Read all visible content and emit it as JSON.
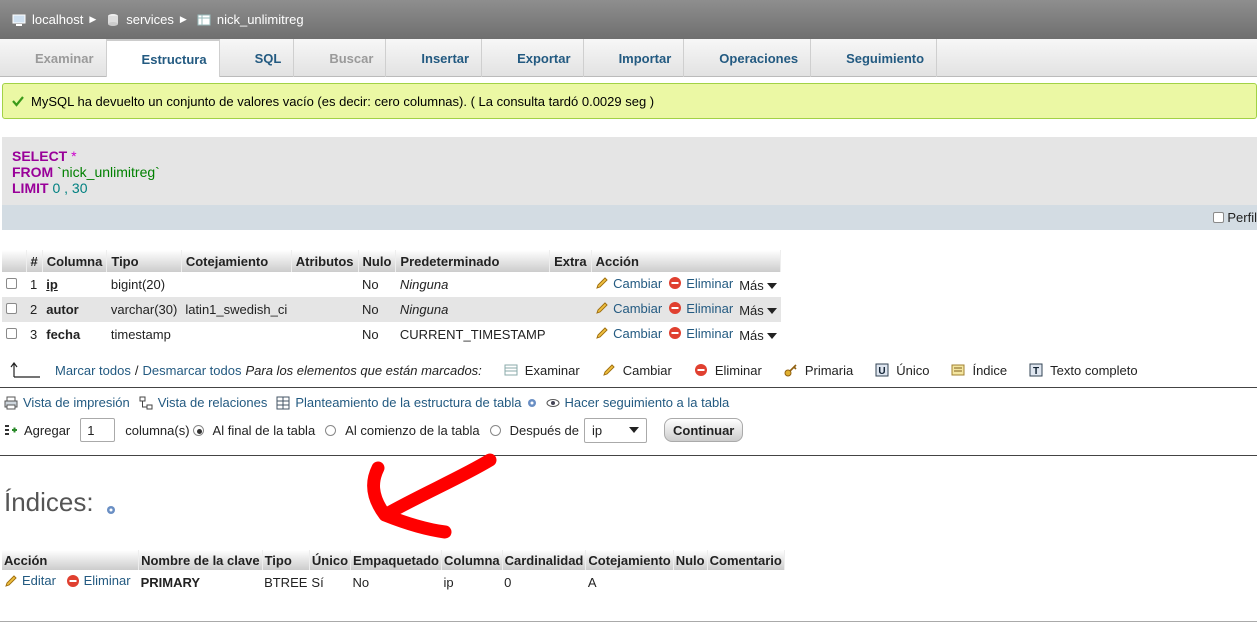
{
  "breadcrumb": {
    "server": "localhost",
    "database": "services",
    "table": "nick_unlimitreg"
  },
  "tabs": [
    {
      "label": "Examinar",
      "icon": "browse-icon",
      "state": "disabled"
    },
    {
      "label": "Estructura",
      "icon": "structure-icon",
      "state": "active"
    },
    {
      "label": "SQL",
      "icon": "sql-icon",
      "state": "normal"
    },
    {
      "label": "Buscar",
      "icon": "search-icon",
      "state": "disabled"
    },
    {
      "label": "Insertar",
      "icon": "insert-icon",
      "state": "normal"
    },
    {
      "label": "Exportar",
      "icon": "export-icon",
      "state": "normal"
    },
    {
      "label": "Importar",
      "icon": "import-icon",
      "state": "normal"
    },
    {
      "label": "Operaciones",
      "icon": "wrench-icon",
      "state": "normal"
    },
    {
      "label": "Seguimiento",
      "icon": "eye-icon",
      "state": "normal"
    }
  ],
  "notice": {
    "text": "MySQL ha devuelto un conjunto de valores vacío (es decir: cero columnas). ( La consulta tardó 0.0029 seg )"
  },
  "sql": {
    "select_kw": "SELECT",
    "star": "*",
    "from_kw": "FROM",
    "table": "`nick_unlimitreg`",
    "limit_kw": "LIMIT",
    "limit_a": "0",
    "limit_sep": ",",
    "limit_b": "30",
    "perfil_label": "Perfil"
  },
  "structure": {
    "headers": [
      "#",
      "Columna",
      "Tipo",
      "Cotejamiento",
      "Atributos",
      "Nulo",
      "Predeterminado",
      "Extra",
      "Acción"
    ],
    "rows": [
      {
        "num": "1",
        "name": "ip",
        "type": "bigint(20)",
        "collation": "",
        "attributes": "",
        "null": "No",
        "default": "Ninguna",
        "extra": ""
      },
      {
        "num": "2",
        "name": "autor",
        "type": "varchar(30)",
        "collation": "latin1_swedish_ci",
        "attributes": "",
        "null": "No",
        "default": "Ninguna",
        "extra": ""
      },
      {
        "num": "3",
        "name": "fecha",
        "type": "timestamp",
        "collation": "",
        "attributes": "",
        "null": "No",
        "default": "CURRENT_TIMESTAMP",
        "extra": ""
      }
    ],
    "action_change": "Cambiar",
    "action_delete": "Eliminar",
    "action_more": "Más"
  },
  "bulk": {
    "check_all": "Marcar todos",
    "separator": "/",
    "uncheck_all": "Desmarcar todos",
    "with_selected": "Para los elementos que están marcados:",
    "buttons": [
      "Examinar",
      "Cambiar",
      "Eliminar",
      "Primaria",
      "Único",
      "Índice",
      "Texto completo"
    ]
  },
  "links": {
    "print_view": "Vista de impresión",
    "relation_view": "Vista de relaciones",
    "propose_structure": "Planteamiento de la estructura de tabla",
    "track_table": "Hacer seguimiento a la tabla"
  },
  "add": {
    "label": "Agregar",
    "count": "1",
    "columns_label": "columna(s)",
    "opt_end": "Al final de la tabla",
    "opt_start": "Al comienzo de la tabla",
    "opt_after": "Después de",
    "after_value": "ip",
    "go": "Continuar"
  },
  "indexes": {
    "title": "Índices:",
    "headers": [
      "Acción",
      "Nombre de la clave",
      "Tipo",
      "Único",
      "Empaquetado",
      "Columna",
      "Cardinalidad",
      "Cotejamiento",
      "Nulo",
      "Comentario"
    ],
    "row": {
      "edit": "Editar",
      "delete": "Eliminar",
      "key_name": "PRIMARY",
      "type": "BTREE",
      "unique": "Sí",
      "packed": "No",
      "column": "ip",
      "cardinality": "0",
      "collation": "A",
      "null": "",
      "comment": ""
    }
  }
}
